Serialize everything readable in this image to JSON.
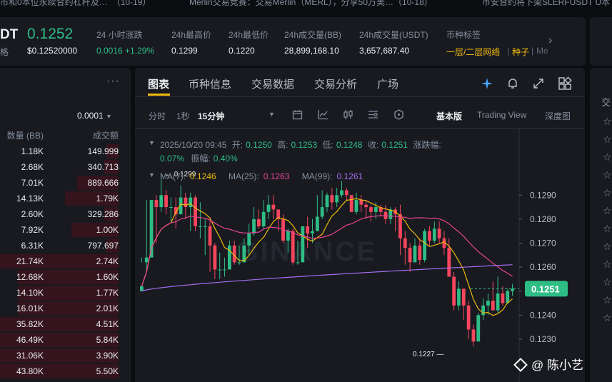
{
  "ticker": [
    {
      "text": "市和0本位永续合约杠杆及…",
      "time": "（10-19）"
    },
    {
      "text": "Merlin交易竞赛：交易Merlin（MERL），分享50万美…",
      "time": "（10-18）"
    },
    {
      "text": "币安合约将下架SLERFUSDT U本"
    }
  ],
  "header": {
    "symbol_tail": "DT",
    "symbol_sub": "格",
    "price": "0.1252",
    "price_usd": "$0.12520000",
    "stats": [
      {
        "label": "24 小时涨跌",
        "value": "0.0016 +1.29%"
      },
      {
        "label": "24h最高价",
        "value": "0.1299"
      },
      {
        "label": "24h最低价",
        "value": "0.1220"
      },
      {
        "label": "24h成交量(BB)",
        "value": "28,899,168.10"
      },
      {
        "label": "24h成交量(USDT)",
        "value": "3,657,687.40"
      },
      {
        "label": "币种标签",
        "value": "一层/二层网络",
        "value2": "种子",
        "value3": "Me"
      }
    ]
  },
  "orderbook": {
    "precision": "0.0001",
    "col_qty": "数量 (BB)",
    "col_total": "成交额",
    "rows": [
      {
        "q": "1.18K",
        "t": "149.999",
        "depth": 0.1
      },
      {
        "q": "2.68K",
        "t": "340.713",
        "depth": 0.12
      },
      {
        "q": "7.01K",
        "t": "889.666",
        "depth": 0.35
      },
      {
        "q": "14.13K",
        "t": "1.79K",
        "depth": 0.45
      },
      {
        "q": "2.60K",
        "t": "329.286",
        "depth": 0.12
      },
      {
        "q": "7.92K",
        "t": "1.00K",
        "depth": 0.4
      },
      {
        "q": "6.31K",
        "t": "797.697",
        "depth": 0.1
      },
      {
        "q": "21.74K",
        "t": "2.74K",
        "depth": 1.0
      },
      {
        "q": "12.68K",
        "t": "1.60K",
        "depth": 0.85
      },
      {
        "q": "14.10K",
        "t": "1.77K",
        "depth": 0.85
      },
      {
        "q": "16.01K",
        "t": "2.01K",
        "depth": 0.85
      },
      {
        "q": "35.82K",
        "t": "4.51K",
        "depth": 1.0
      },
      {
        "q": "46.49K",
        "t": "5.84K",
        "depth": 1.0
      },
      {
        "q": "31.06K",
        "t": "3.90K",
        "depth": 1.0
      },
      {
        "q": "43.80K",
        "t": "5.50K",
        "depth": 1.0
      }
    ]
  },
  "chart_tabs": [
    "图表",
    "币种信息",
    "交易数据",
    "交易分析",
    "广场"
  ],
  "toolbar": {
    "intervals": [
      "分时",
      "1秒",
      "15分钟"
    ],
    "views": [
      "基本版",
      "Trading View",
      "深度图"
    ]
  },
  "ohlc": {
    "time": "2025/10/20 09:45",
    "open_label": "开:",
    "open": "0.1250",
    "high_label": "高:",
    "high": "0.1253",
    "low_label": "低:",
    "low": "0.1248",
    "close_label": "收:",
    "close": "0.1251",
    "chg_label": "涨跌幅:",
    "chg": "0.07%",
    "amp_label": "振幅:",
    "amp": "0.40%"
  },
  "ma": [
    {
      "label": "MA(7):",
      "value": "0.1246",
      "color": "#f0b90b"
    },
    {
      "label": "MA(25):",
      "value": "0.1263",
      "color": "#e84393"
    },
    {
      "label": "MA(99):",
      "value": "0.1261",
      "color": "#a56df0"
    }
  ],
  "watermark": "BINANCE",
  "signature": "@ 陈小艺",
  "chart_data": {
    "type": "candlestick",
    "y_ticks": [
      "0.1290",
      "0.1280",
      "0.1270",
      "0.1260",
      "0.1250",
      "0.1240",
      "0.1230"
    ],
    "y_range": [
      0.1227,
      0.1299
    ],
    "last_price": "0.1251",
    "high_marker": "0.1299",
    "low_marker": "0.1227",
    "candles": [
      [
        0.1252,
        0.1264,
        0.1262,
        0.125
      ],
      [
        0.1264,
        0.1288,
        0.1258,
        0.1262
      ],
      [
        0.1288,
        0.1288,
        0.1275,
        0.1264
      ],
      [
        0.1285,
        0.129,
        0.127,
        0.1288
      ],
      [
        0.129,
        0.1299,
        0.1283,
        0.1285
      ],
      [
        0.1285,
        0.1292,
        0.1282,
        0.129
      ],
      [
        0.1285,
        0.1289,
        0.1279,
        0.1285
      ],
      [
        0.1282,
        0.1289,
        0.1276,
        0.1285
      ],
      [
        0.1289,
        0.1294,
        0.1286,
        0.1282
      ],
      [
        0.1285,
        0.1291,
        0.128,
        0.1289
      ],
      [
        0.1289,
        0.1291,
        0.1275,
        0.1285
      ],
      [
        0.1277,
        0.129,
        0.1275,
        0.1289
      ],
      [
        0.1277,
        0.1287,
        0.1272,
        0.1277
      ],
      [
        0.1277,
        0.128,
        0.1265,
        0.1277
      ],
      [
        0.1269,
        0.128,
        0.1258,
        0.1277
      ],
      [
        0.1259,
        0.127,
        0.1255,
        0.1269
      ],
      [
        0.1259,
        0.1266,
        0.1255,
        0.1259
      ],
      [
        0.1259,
        0.1264,
        0.1256,
        0.1259
      ],
      [
        0.1269,
        0.1271,
        0.1259,
        0.1259
      ],
      [
        0.1262,
        0.1271,
        0.1261,
        0.1269
      ],
      [
        0.1262,
        0.1269,
        0.1261,
        0.1262
      ],
      [
        0.1269,
        0.1272,
        0.1262,
        0.1262
      ],
      [
        0.1274,
        0.1278,
        0.1265,
        0.1269
      ],
      [
        0.128,
        0.1285,
        0.1273,
        0.1274
      ],
      [
        0.1277,
        0.1284,
        0.1276,
        0.128
      ],
      [
        0.1283,
        0.1288,
        0.1276,
        0.1277
      ],
      [
        0.1286,
        0.129,
        0.128,
        0.1283
      ],
      [
        0.1284,
        0.129,
        0.128,
        0.1286
      ],
      [
        0.128,
        0.1284,
        0.1275,
        0.1284
      ],
      [
        0.1271,
        0.1282,
        0.127,
        0.128
      ],
      [
        0.1275,
        0.1276,
        0.1266,
        0.1271
      ],
      [
        0.1262,
        0.1276,
        0.1261,
        0.1275
      ],
      [
        0.1262,
        0.1271,
        0.1261,
        0.1262
      ],
      [
        0.1277,
        0.1277,
        0.1262,
        0.1262
      ],
      [
        0.1274,
        0.1281,
        0.1268,
        0.1277
      ],
      [
        0.1275,
        0.128,
        0.127,
        0.1274
      ],
      [
        0.1281,
        0.129,
        0.1275,
        0.1275
      ],
      [
        0.1285,
        0.1292,
        0.128,
        0.1281
      ],
      [
        0.129,
        0.1291,
        0.1283,
        0.1285
      ],
      [
        0.1287,
        0.1293,
        0.1284,
        0.129
      ],
      [
        0.129,
        0.1293,
        0.1285,
        0.1287
      ],
      [
        0.1292,
        0.1296,
        0.1289,
        0.129
      ],
      [
        0.129,
        0.1293,
        0.1288,
        0.1292
      ],
      [
        0.1283,
        0.129,
        0.1283,
        0.129
      ],
      [
        0.1288,
        0.1291,
        0.1282,
        0.1283
      ],
      [
        0.1286,
        0.129,
        0.1283,
        0.1288
      ],
      [
        0.1285,
        0.1288,
        0.128,
        0.1286
      ],
      [
        0.1283,
        0.1286,
        0.1279,
        0.1285
      ],
      [
        0.1285,
        0.1287,
        0.128,
        0.1283
      ],
      [
        0.1283,
        0.1286,
        0.1281,
        0.1285
      ],
      [
        0.128,
        0.1286,
        0.1278,
        0.1283
      ],
      [
        0.1284,
        0.1285,
        0.1278,
        0.128
      ],
      [
        0.1282,
        0.1285,
        0.1275,
        0.1284
      ],
      [
        0.1272,
        0.1286,
        0.1265,
        0.1282
      ],
      [
        0.1268,
        0.1275,
        0.1261,
        0.1272
      ],
      [
        0.1262,
        0.127,
        0.1258,
        0.1268
      ],
      [
        0.1269,
        0.1272,
        0.1262,
        0.1262
      ],
      [
        0.1263,
        0.1272,
        0.1261,
        0.1269
      ],
      [
        0.1275,
        0.1276,
        0.1262,
        0.1263
      ],
      [
        0.1271,
        0.1277,
        0.1269,
        0.1275
      ],
      [
        0.1276,
        0.1279,
        0.127,
        0.1271
      ],
      [
        0.1272,
        0.1279,
        0.127,
        0.1276
      ],
      [
        0.1268,
        0.1275,
        0.1265,
        0.1272
      ],
      [
        0.1256,
        0.1272,
        0.1256,
        0.1268
      ],
      [
        0.1244,
        0.1258,
        0.1242,
        0.1256
      ],
      [
        0.1251,
        0.1254,
        0.1242,
        0.1244
      ],
      [
        0.1244,
        0.1251,
        0.1238,
        0.1251
      ],
      [
        0.1234,
        0.1246,
        0.123,
        0.1244
      ],
      [
        0.1229,
        0.1236,
        0.1227,
        0.1234
      ],
      [
        0.124,
        0.1241,
        0.123,
        0.1229
      ],
      [
        0.1244,
        0.1247,
        0.1238,
        0.124
      ],
      [
        0.1246,
        0.1249,
        0.124,
        0.1244
      ],
      [
        0.1242,
        0.1254,
        0.1242,
        0.1246
      ],
      [
        0.1249,
        0.1256,
        0.1241,
        0.1242
      ],
      [
        0.1245,
        0.1252,
        0.1244,
        0.1249
      ],
      [
        0.125,
        0.1251,
        0.1245,
        0.1245
      ],
      [
        0.1251,
        0.1253,
        0.1248,
        0.125
      ]
    ]
  }
}
